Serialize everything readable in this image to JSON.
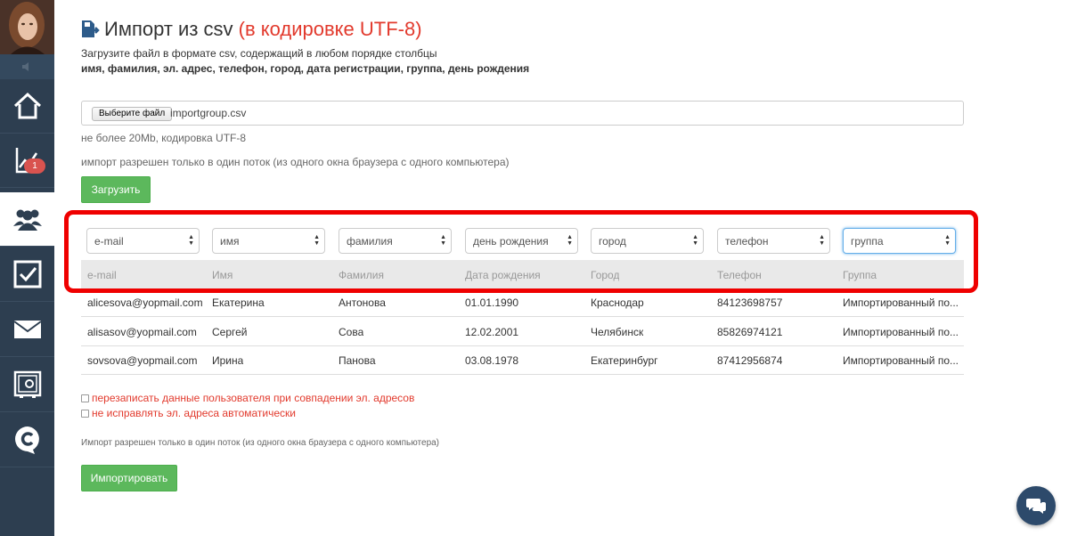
{
  "sidebar": {
    "items": [
      {
        "name": "home-icon"
      },
      {
        "name": "chart-icon",
        "badge": "1"
      },
      {
        "name": "users-icon",
        "active": true
      },
      {
        "name": "checkbox-icon"
      },
      {
        "name": "mail-icon"
      },
      {
        "name": "safe-icon"
      },
      {
        "name": "c-logo-icon"
      }
    ]
  },
  "header": {
    "title": "Импорт из csv",
    "title_accent": "(в кодировке UTF-8)",
    "subtitle": "Загрузите файл в формате csv, содержащий в любом порядке столбцы",
    "columns_note": "имя, фамилия, эл. адрес, телефон, город, дата регистрации, группа, день рождения"
  },
  "upload": {
    "choose_label": "Выберите файл",
    "file_name": "importgroup.csv",
    "hint_size": "не более 20Mb, кодировка UTF-8",
    "hint_thread": "импорт разрешен только в один поток (из одного окна браузера с одного компьютера)",
    "upload_label": "Загрузить"
  },
  "mapping": {
    "selects": [
      "e-mail",
      "имя",
      "фамилия",
      "день рождения",
      "город",
      "телефон",
      "группа"
    ],
    "headers": [
      "e-mail",
      "Имя",
      "Фамилия",
      "Дата рождения",
      "Город",
      "Телефон",
      "Группа"
    ],
    "rows": [
      [
        "alicesova@yopmail.com",
        "Екатерина",
        "Антонова",
        "01.01.1990",
        "Краснодар",
        "84123698757",
        "Импортированный по..."
      ],
      [
        "alisasov@yopmail.com",
        "Сергей",
        "Сова",
        "12.02.2001",
        "Челябинск",
        "85826974121",
        "Импортированный по..."
      ],
      [
        "sovsova@yopmail.com",
        "Ирина",
        "Панова",
        "03.08.1978",
        "Екатеринбург",
        "87412956874",
        "Импортированный по..."
      ]
    ]
  },
  "options": {
    "overwrite": "перезаписать данные пользователя при совпадении эл. адресов",
    "no_fix": "не исправлять эл. адреса автоматически"
  },
  "footer": {
    "note": "Импорт разрешен только в один поток (из одного окна браузера с одного компьютера)",
    "import_label": "Импортировать"
  },
  "colors": {
    "sidebar": "#2d3e50",
    "accent_red": "#e23a2d",
    "button_green": "#5cb85c",
    "highlight": "#ef0000"
  }
}
